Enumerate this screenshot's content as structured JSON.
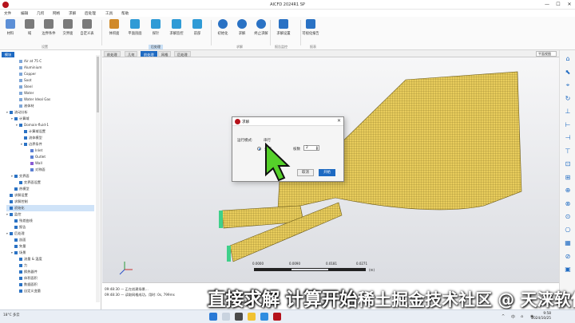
{
  "window": {
    "title": "AICFD 2024R1 SP",
    "minimize": "—",
    "maximize": "☐",
    "close": "✕"
  },
  "menu": [
    "文件",
    "编辑",
    "几何",
    "网格",
    "求解",
    "后处理",
    "工具",
    "帮助"
  ],
  "ribbon": {
    "buttons": [
      {
        "label": "材料",
        "icon": "material-icon",
        "color": "#5c8fd6"
      },
      {
        "label": "域",
        "icon": "domain-icon",
        "color": "#7a7a7a"
      },
      {
        "label": "边界条件",
        "icon": "boundary-condition-icon",
        "color": "#7a7a7a"
      },
      {
        "label": "交界面",
        "icon": "interface-icon",
        "color": "#7a7a7a"
      },
      {
        "label": "自定义表",
        "icon": "custom-table-icon",
        "color": "#7a7a7a"
      },
      {
        "label": "体积面",
        "icon": "volume-face-icon",
        "color": "#d08a2a"
      },
      {
        "label": "平面剖面",
        "icon": "plane-section-icon",
        "color": "#2f9bd6"
      },
      {
        "label": "探针",
        "icon": "probe-icon",
        "color": "#2f9bd6"
      },
      {
        "label": "求解监控",
        "icon": "solve-monitor-icon",
        "color": "#2f9bd6"
      },
      {
        "label": "前部",
        "icon": "front-icon",
        "color": "#2f9bd6"
      },
      {
        "label": "初始化",
        "icon": "initialize-icon",
        "color": "#2a72c4"
      },
      {
        "label": "求解",
        "icon": "solve-icon",
        "color": "#2a72c4"
      },
      {
        "label": "终止求解",
        "icon": "stop-solve-icon",
        "color": "#2a72c4"
      },
      {
        "label": "求解设置",
        "icon": "solve-settings-icon",
        "color": "#2a72c4"
      },
      {
        "label": "可视化报告",
        "icon": "visual-report-icon",
        "color": "#2a72c4"
      }
    ],
    "groups": [
      "设置",
      "后处理",
      "求解",
      "报告监控",
      "报表"
    ]
  },
  "left_panel": {
    "tab": "模块",
    "tree": [
      {
        "label": "Air at 75 C",
        "toggle": "",
        "icon_color": "#7fa7d8",
        "selected": false
      },
      {
        "label": "Aluminium",
        "toggle": "",
        "icon_color": "#7fa7d8",
        "selected": false
      },
      {
        "label": "Copper",
        "toggle": "",
        "icon_color": "#7fa7d8",
        "selected": false
      },
      {
        "label": "Soot",
        "toggle": "",
        "icon_color": "#7fa7d8",
        "selected": false
      },
      {
        "label": "Steel",
        "toggle": "",
        "icon_color": "#7fa7d8",
        "selected": false
      },
      {
        "label": "Water",
        "toggle": "",
        "icon_color": "#7fa7d8",
        "selected": false
      },
      {
        "label": "Water Ideal Gas",
        "toggle": "",
        "icon_color": "#7fa7d8",
        "selected": false
      },
      {
        "label": "液体材",
        "toggle": "",
        "icon_color": "#7fa7d8",
        "selected": false
      },
      {
        "label": "流动分析",
        "toggle": "▾",
        "icon_color": "#2a72c4",
        "selected": false
      },
      {
        "label": "计算域",
        "toggle": "▾",
        "icon_color": "#2a72c4",
        "selected": false
      },
      {
        "label": "Domain-fluid-1",
        "toggle": "▾",
        "icon_color": "#2a72c4",
        "selected": false
      },
      {
        "label": "计算域设置",
        "toggle": "",
        "icon_color": "#2a72c4",
        "selected": false
      },
      {
        "label": "流体模型",
        "toggle": "",
        "icon_color": "#2a72c4",
        "selected": false
      },
      {
        "label": "边界条件",
        "toggle": "▾",
        "icon_color": "#2a72c4",
        "selected": false
      },
      {
        "label": "Inlet",
        "toggle": "",
        "icon_color": "#5b7fd4",
        "selected": false
      },
      {
        "label": "Outlet",
        "toggle": "",
        "icon_color": "#5b7fd4",
        "selected": false
      },
      {
        "label": "Wall",
        "toggle": "",
        "icon_color": "#8a5bd4",
        "selected": false
      },
      {
        "label": "对称面",
        "toggle": "",
        "icon_color": "#5b7fd4",
        "selected": false
      },
      {
        "label": "交界面",
        "toggle": "▾",
        "icon_color": "#2a72c4",
        "selected": false
      },
      {
        "label": "交界面设置",
        "toggle": "",
        "icon_color": "#2a72c4",
        "selected": false
      },
      {
        "label": "热模型",
        "toggle": "",
        "icon_color": "#2a72c4",
        "selected": false
      },
      {
        "label": "求解设置",
        "toggle": "",
        "icon_color": "#2a72c4",
        "selected": false
      },
      {
        "label": "求解控制",
        "toggle": "",
        "icon_color": "#2a72c4",
        "selected": false
      },
      {
        "label": "初始化",
        "toggle": "",
        "icon_color": "#2a72c4",
        "selected": true
      },
      {
        "label": "监控",
        "toggle": "▾",
        "icon_color": "#2a72c4",
        "selected": false
      },
      {
        "label": "残差曲线",
        "toggle": "",
        "icon_color": "#2a72c4",
        "selected": false
      },
      {
        "label": "报告",
        "toggle": "",
        "icon_color": "#2a72c4",
        "selected": false
      },
      {
        "label": "后处理",
        "toggle": "▾",
        "icon_color": "#2a72c4",
        "selected": false
      },
      {
        "label": "剖面",
        "toggle": "",
        "icon_color": "#2a72c4",
        "selected": false
      },
      {
        "label": "矢量",
        "toggle": "",
        "icon_color": "#2a72c4",
        "selected": false
      },
      {
        "label": "场景",
        "toggle": "▾",
        "icon_color": "#2a72c4",
        "selected": false
      },
      {
        "label": "流量 & 温度",
        "toggle": "",
        "icon_color": "#2a72c4",
        "selected": false
      },
      {
        "label": "力",
        "toggle": "",
        "icon_color": "#2a72c4",
        "selected": false
      },
      {
        "label": "换热器件",
        "toggle": "",
        "icon_color": "#2a72c4",
        "selected": false
      },
      {
        "label": "体积面积",
        "toggle": "",
        "icon_color": "#2a72c4",
        "selected": false
      },
      {
        "label": "数据面积",
        "toggle": "",
        "icon_color": "#2a72c4",
        "selected": false
      },
      {
        "label": "自定义变量",
        "toggle": "",
        "icon_color": "#2a72c4",
        "selected": false
      }
    ]
  },
  "view_tabs": [
    "前处理",
    "几何",
    "前处理",
    "网格",
    "后处理"
  ],
  "view_tab_active": 2,
  "view_select": "平面视图",
  "scale": {
    "labels": [
      "0.0000",
      "0.0090",
      "0.0181",
      "0.0271"
    ],
    "unit": "(m)"
  },
  "dialog": {
    "title": "求解",
    "close": "✕",
    "mode_label": "运行模式:",
    "option_serial": "串行",
    "option_parallel": "并行",
    "threads_label": "核数",
    "threads_value": "2",
    "cancel": "取消",
    "ok": "开始"
  },
  "console": [
    "09:48:30 — 正在创建场景...",
    "09:48:30 — 读取网格成功，用时: 0s, 799ms"
  ],
  "subtitle": "直接求解 计算开始",
  "watermark": "稀土掘金技术社区 @ 天涞软件",
  "taskbar": {
    "weather_temp": "18°C",
    "weather_text": "多云",
    "time": "9:58",
    "date": "2024/10/25",
    "tray": [
      "^",
      "中",
      "⌂",
      "◉"
    ]
  },
  "right_tools": [
    "⌂",
    "⬉",
    "⌖",
    "↻",
    "⊥",
    "⊢",
    "⊣",
    "⊤",
    "⊡",
    "⊞",
    "⊕",
    "⊗",
    "⊙",
    "⎔",
    "▦",
    "⊘",
    "▣"
  ],
  "colors": {
    "accent": "#1e6ac2",
    "mesh": "#e8cc5c",
    "mesh_line": "#7a6a20",
    "inlet": "#3fd08a"
  }
}
